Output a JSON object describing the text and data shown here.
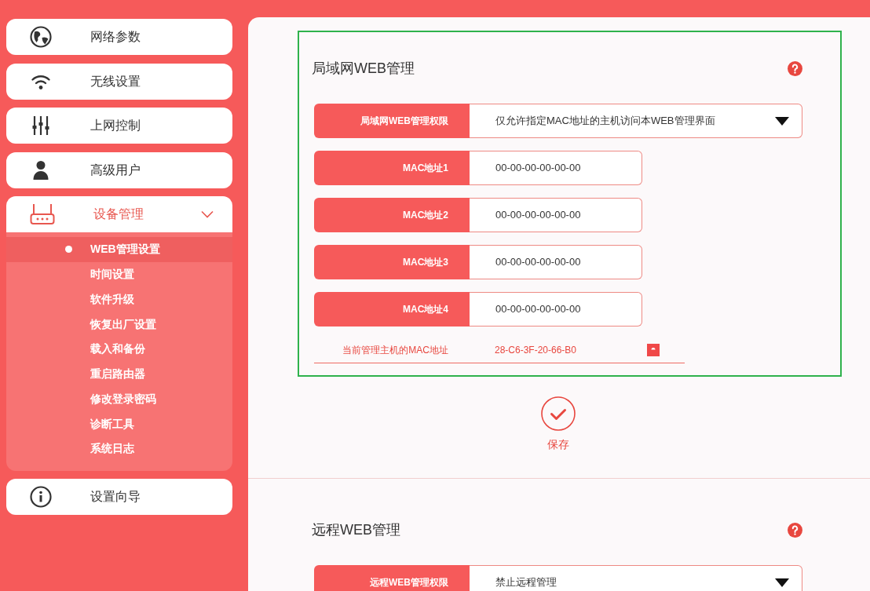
{
  "sidebar": {
    "items": [
      {
        "label": "网络参数",
        "selected": false
      },
      {
        "label": "无线设置",
        "selected": false
      },
      {
        "label": "上网控制",
        "selected": false
      },
      {
        "label": "高级用户",
        "selected": false
      },
      {
        "label": "设备管理",
        "selected": true,
        "expanded": true,
        "children": [
          {
            "label": "WEB管理设置",
            "selected": true
          },
          {
            "label": "时间设置",
            "selected": false
          },
          {
            "label": "软件升级",
            "selected": false
          },
          {
            "label": "恢复出厂设置",
            "selected": false
          },
          {
            "label": "载入和备份",
            "selected": false
          },
          {
            "label": "重启路由器",
            "selected": false
          },
          {
            "label": "修改登录密码",
            "selected": false
          },
          {
            "label": "诊断工具",
            "selected": false
          },
          {
            "label": "系统日志",
            "selected": false
          }
        ]
      },
      {
        "label": "设置向导",
        "selected": false
      }
    ]
  },
  "sections": [
    {
      "title": "局域网WEB管理",
      "highlighted": true,
      "fields": [
        {
          "kind": "select",
          "label": "局域网WEB管理权限",
          "value": "仅允许指定MAC地址的主机访问本WEB管理界面"
        },
        {
          "kind": "text",
          "label": "MAC地址1",
          "value": "00-00-00-00-00-00"
        },
        {
          "kind": "text",
          "label": "MAC地址2",
          "value": "00-00-00-00-00-00"
        },
        {
          "kind": "text",
          "label": "MAC地址3",
          "value": "00-00-00-00-00-00"
        },
        {
          "kind": "text",
          "label": "MAC地址4",
          "value": "00-00-00-00-00-00"
        }
      ],
      "current_host": {
        "label": "当前管理主机的MAC地址",
        "value": "28-C6-3F-20-66-B0"
      },
      "save_button": {
        "label": "保存"
      }
    },
    {
      "title": "远程WEB管理",
      "highlighted": false,
      "fields": [
        {
          "kind": "select",
          "label": "远程WEB管理权限",
          "value": "禁止远程管理"
        }
      ]
    }
  ]
}
